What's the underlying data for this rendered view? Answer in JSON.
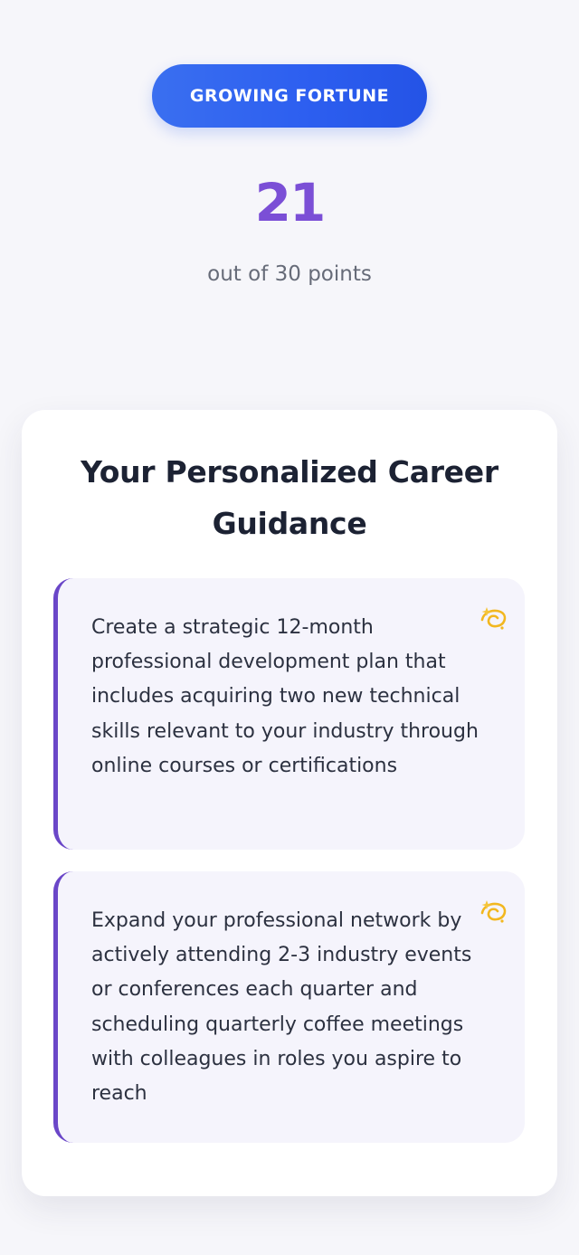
{
  "badge": {
    "label": "GROWING FORTUNE"
  },
  "score": {
    "value": "21",
    "caption": "out of 30 points"
  },
  "guidance": {
    "title": "Your Personalized Career Guidance",
    "tips": [
      {
        "text": "Create a strategic 12-month professional development plan that includes acquiring two new technical skills relevant to your industry through online courses or certifications",
        "icon": "dizzy-star-icon"
      },
      {
        "text": "Expand your professional network by actively attending 2-3 industry events or conferences each quarter and scheduling quarterly coffee meetings with colleagues in roles you aspire to reach",
        "icon": "dizzy-star-icon"
      }
    ]
  },
  "colors": {
    "accent_blue": "#2d5ff0",
    "score_purple": "#7b4fd6",
    "tip_border": "#6a46c8",
    "tip_background": "#f5f4fc"
  }
}
